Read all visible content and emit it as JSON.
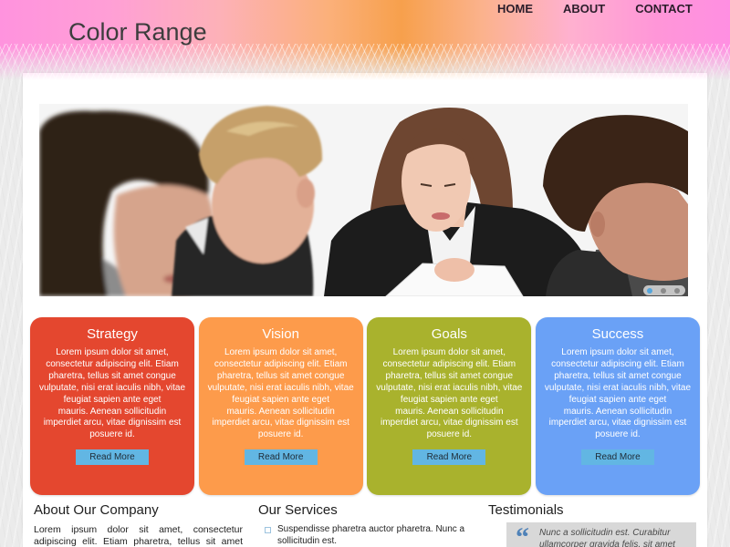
{
  "header": {
    "title": "Color Range",
    "nav": [
      "HOME",
      "ABOUT",
      "CONTACT"
    ]
  },
  "slider": {
    "slide_count": 3,
    "active_slide": 1
  },
  "theme": {
    "button_color": "#62b6e3",
    "quote_mark_color": "#4f82b8"
  },
  "features": [
    {
      "title": "Strategy",
      "text": "Lorem ipsum dolor sit amet,\nconsectetur adipiscing elit. Etiam\npharetra, tellus sit amet congue\nvulputate, nisi erat iaculis nibh, vitae\nfeugiat sapien ante eget\nmauris. Aenean sollicitudin\nimperdiet arcu, vitae dignissim est\nposuere id.",
      "button": "Read More",
      "color": "#e4472f"
    },
    {
      "title": "Vision",
      "text": "Lorem ipsum dolor sit amet,\nconsectetur adipiscing elit. Etiam\npharetra, tellus sit amet congue\nvulputate, nisi erat iaculis nibh, vitae\nfeugiat sapien ante eget\nmauris. Aenean sollicitudin\nimperdiet arcu, vitae dignissim est\nposuere id.",
      "button": "Read More",
      "color": "#fd9b4b"
    },
    {
      "title": "Goals",
      "text": "Lorem ipsum dolor sit amet,\nconsectetur adipiscing elit. Etiam\npharetra, tellus sit amet congue\nvulputate, nisi erat iaculis nibh, vitae\nfeugiat sapien ante eget\nmauris. Aenean sollicitudin\nimperdiet arcu, vitae dignissim est\nposuere id.",
      "button": "Read More",
      "color": "#a9b22d"
    },
    {
      "title": "Success",
      "text": "Lorem ipsum dolor sit amet,\nconsectetur adipiscing elit. Etiam\npharetra, tellus sit amet congue\nvulputate, nisi erat iaculis nibh, vitae\nfeugiat sapien ante eget\nmauris. Aenean sollicitudin\nimperdiet arcu, vitae dignissim est\nposuere id.",
      "button": "Read More",
      "color": "#6aa1f6"
    }
  ],
  "about": {
    "heading": "About Our Company",
    "text": "Lorem ipsum dolor sit amet, consectetur adipiscing elit. Etiam pharetra, tellus sit amet"
  },
  "services": {
    "heading": "Our Services",
    "items": [
      "Suspendisse pharetra auctor pharetra. Nunc a sollicitudin est."
    ]
  },
  "testimonials": {
    "heading": "Testimonials",
    "icon": "quote-icon",
    "quote": "Nunc a sollicitudin est. Curabitur ullamcorper gravida felis, sit amet"
  }
}
